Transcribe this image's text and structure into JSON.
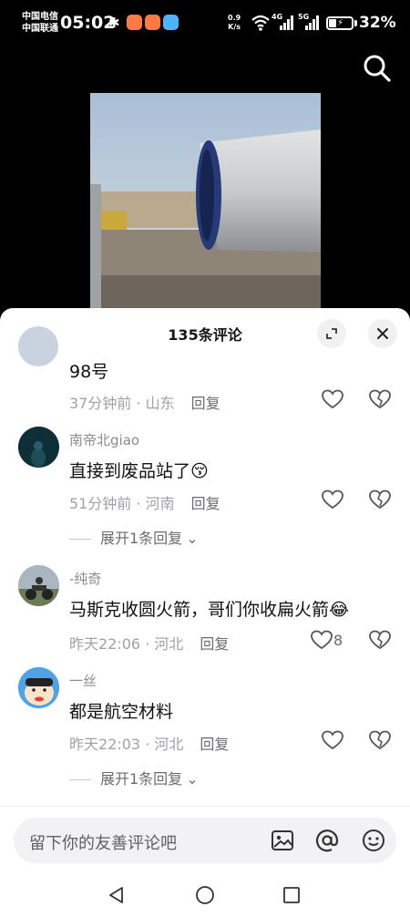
{
  "status_bar": {
    "carrier_1": "中国电信",
    "carrier_2": "中国联通",
    "time": "05:02",
    "net_speed_value": "0.9",
    "net_speed_unit": "K/s",
    "net_1": "4G",
    "net_2": "5G",
    "battery": "32%",
    "battery_level": 0.32
  },
  "sheet": {
    "title": "135条评论"
  },
  "comments": [
    {
      "user": "",
      "text": "98号",
      "time_location": "37分钟前 · 山东",
      "reply_label": "回复"
    },
    {
      "user": "南帝北giao",
      "text": "直接到废品站了",
      "emoji": "😚",
      "time_location": "51分钟前 · 河南",
      "reply_label": "回复",
      "expand_label": "展开1条回复"
    },
    {
      "user": "-纯奇",
      "text": "马斯克收圆火箭，哥们你收扁火箭",
      "emoji": "😂",
      "time_location": "昨天22:06 · 河北",
      "reply_label": "回复",
      "likes": "8"
    },
    {
      "user": "一丝",
      "text": "都是航空材料",
      "time_location": "昨天22:03 · 河北",
      "reply_label": "回复",
      "expand_label": "展开1条回复"
    }
  ],
  "input": {
    "placeholder": "留下你的友善评论吧"
  },
  "colors": {
    "background": "#000000",
    "sheet": "#ffffff",
    "meta_text": "#a1a1a6",
    "input_bg": "#f2f2f4"
  }
}
